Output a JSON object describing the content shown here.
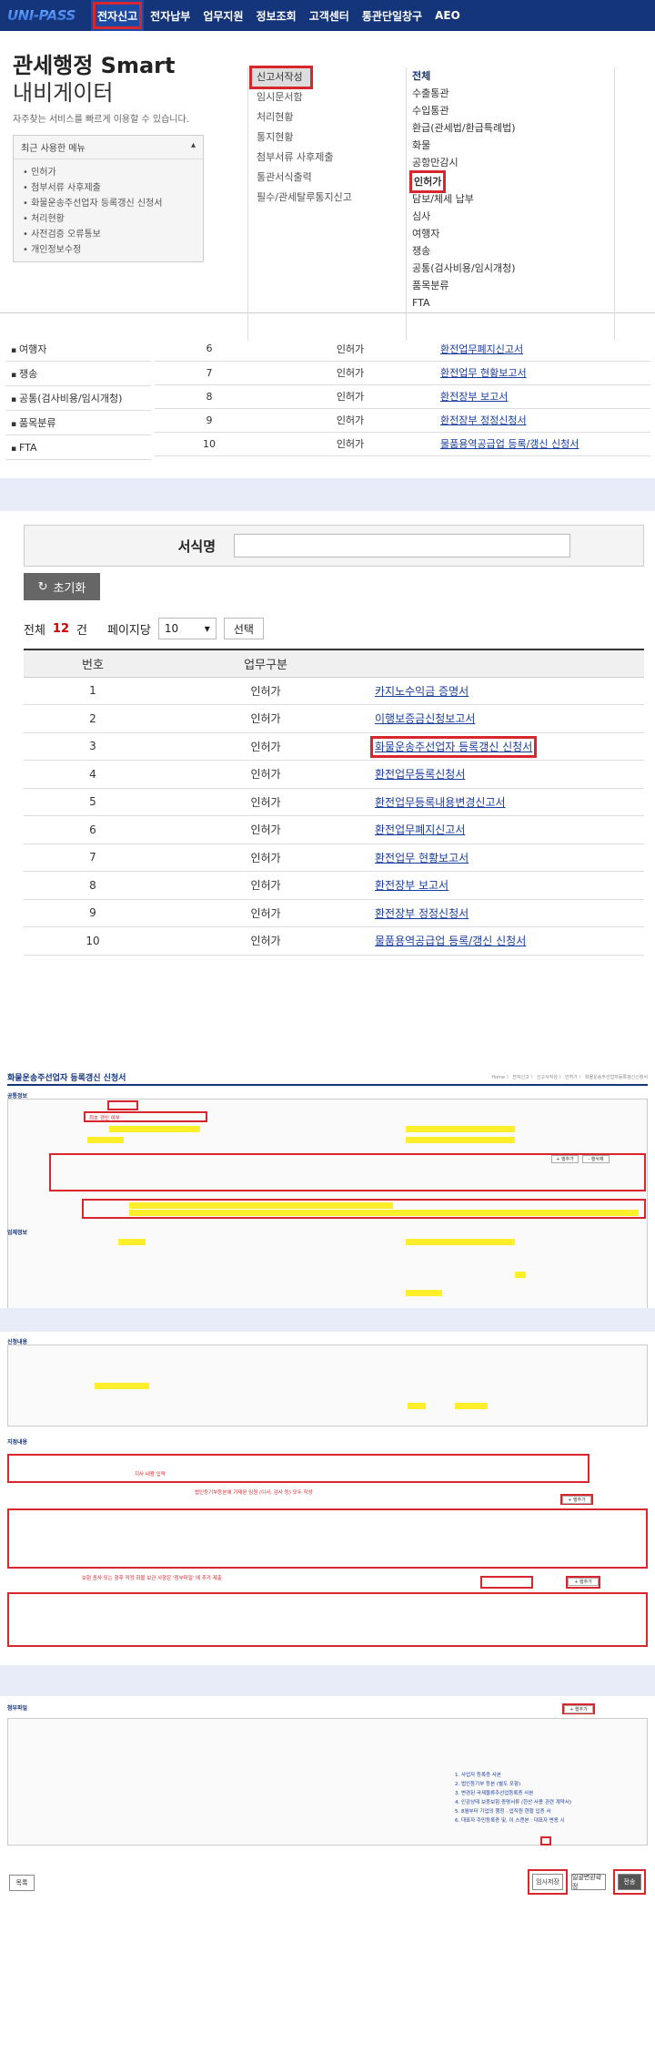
{
  "header": {
    "logo": "UNI-PASS",
    "nav": [
      "전자신고",
      "전자납부",
      "업무지원",
      "정보조회",
      "고객센터",
      "통관단일창구",
      "AEO"
    ]
  },
  "intro": {
    "title": "관세행정 Smart",
    "subtitle": "내비게이터",
    "desc": "자주찾는 서비스를 빠르게 이용할 수 있습니다.",
    "recent_title": "최근 사용한 메뉴",
    "recent_items": [
      "인허가",
      "첨부서류 사후제출",
      "화물운송주선업자 등록갱신 신청서",
      "처리현황",
      "사전검증 오류통보",
      "개인정보수정"
    ]
  },
  "menu_col1": [
    "신고서작성",
    "임시문서함",
    "처리현황",
    "통지현황",
    "첨부서류 사후제출",
    "통관서식출력",
    "필수/관세탈루통지신고"
  ],
  "menu_col2": [
    "전체",
    "수출통관",
    "수입통관",
    "환급(관세법/환급특례법)",
    "화물",
    "공항만감시",
    "인허가",
    "담보/체세 납부",
    "심사",
    "여행자",
    "쟁송",
    "공통(검사비용/임시개청)",
    "품목분류",
    "FTA"
  ],
  "sidebar": [
    "여행자",
    "쟁송",
    "공통(검사비용/임시개청)",
    "품목분류",
    "FTA"
  ],
  "partial_rows": [
    {
      "no": "6",
      "type": "인허가",
      "name": "환전업무폐지신고서"
    },
    {
      "no": "7",
      "type": "인허가",
      "name": "환전업무 현황보고서"
    },
    {
      "no": "8",
      "type": "인허가",
      "name": "환전장부 보고서"
    },
    {
      "no": "9",
      "type": "인허가",
      "name": "환전장부 정정신청서"
    },
    {
      "no": "10",
      "type": "인허가",
      "name": "물품용역공급업 등록/갱신 신청서"
    }
  ],
  "search": {
    "label": "서식명",
    "reset": "초기화",
    "total_prefix": "전체",
    "total_count": "12",
    "total_suffix": "건",
    "perpage_label": "페이지당",
    "perpage_value": "10",
    "pick": "선택"
  },
  "list": {
    "headers": [
      "번호",
      "업무구분",
      ""
    ],
    "rows": [
      {
        "no": "1",
        "type": "인허가",
        "name": "카지노수익금 증명서"
      },
      {
        "no": "2",
        "type": "인허가",
        "name": "이행보증금신청보고서"
      },
      {
        "no": "3",
        "type": "인허가",
        "name": "화물운송주선업자 등록갱신 신청서"
      },
      {
        "no": "4",
        "type": "인허가",
        "name": "환전업무등록신청서"
      },
      {
        "no": "5",
        "type": "인허가",
        "name": "환전업무등록내용변경신고서"
      },
      {
        "no": "6",
        "type": "인허가",
        "name": "환전업무폐지신고서"
      },
      {
        "no": "7",
        "type": "인허가",
        "name": "환전업무 현황보고서"
      },
      {
        "no": "8",
        "type": "인허가",
        "name": "환전장부 보고서"
      },
      {
        "no": "9",
        "type": "인허가",
        "name": "환전장부 정정신청서"
      },
      {
        "no": "10",
        "type": "인허가",
        "name": "물품용역공급업 등록/갱신 신청서"
      }
    ]
  },
  "form": {
    "title": "화물운송주선업자 등록갱신 신청서",
    "crumb": "Home 〉 전자신고 〉 신고서작성 〉 인허가 〉 화물운송주선업자등록갱신신청서",
    "sec_basic": "공통정보",
    "sec_biz": "업체정보",
    "sec_apply": "신청내용",
    "sec_branch": "지점내용",
    "sec_attach": "첨부파일",
    "note_red1": "최초 갱신 여부",
    "note_red2": "지사 내용 입력",
    "note_red3": "법인등기부등본에 기재된 임원 (이사, 감사 등) 모두 작성",
    "note_red4": "보험 종사 또는 향후 적정 화물 보관 사항은 '첨부파일' 에 추가 제출",
    "add": "+ 행추가",
    "del": "- 행삭제",
    "attach_add": "+ 행추가",
    "attach_notes": [
      "1. 사업자 등록증 사본",
      "2. 법인등기부 등본 (별도 포함)",
      "3. 변경된 국제물류주선업등록증 사본",
      "4. 인감상태 보증보험 증명서류 (한산 사용 관련 계약서)",
      "5. 8월부터 기업의 행정 · 업직원 현황 입증 서",
      "6. 대표자 주민등록증 및, 이 스캔본 : 대표자 변동 시"
    ],
    "btn_temp": "임시저장",
    "btn_print": "일괄변환확정",
    "btn_send": "전송",
    "btn_list": "목록"
  },
  "colors": {
    "nav_bg": "#14357a",
    "highlight": "#d8262e",
    "link": "#1b3d9e",
    "band": "#e8ebf8"
  }
}
